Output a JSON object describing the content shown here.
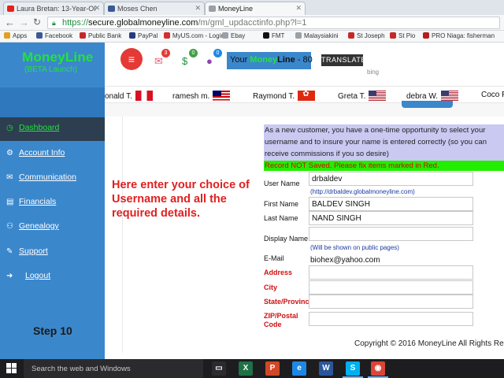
{
  "browser": {
    "tabs": [
      {
        "title": "Laura Bretan: 13-Year-Ol",
        "icon": "youtube-icon",
        "color": "#e62117"
      },
      {
        "title": "Moses Chen",
        "icon": "facebook-icon",
        "color": "#3b5998"
      },
      {
        "title": "MoneyLine",
        "icon": "page-icon",
        "color": "#9aa0a6"
      }
    ],
    "url": {
      "scheme": "https://",
      "domain": "secure.globalmoneyline.com",
      "path": "/m/gml_updacctinfo.php?l=1"
    },
    "bookmarks": [
      {
        "label": "Apps",
        "icon": "apps-icon",
        "color": "#e0a020"
      },
      {
        "label": "Facebook",
        "icon": "facebook-icon",
        "color": "#3b5998"
      },
      {
        "label": "Public Bank",
        "icon": "bank-icon",
        "color": "#c62828"
      },
      {
        "label": "PayPal",
        "icon": "paypal-icon",
        "color": "#253b80"
      },
      {
        "label": "MyUS.com - Login",
        "icon": "myus-icon",
        "color": "#d32f2f"
      },
      {
        "label": "Ebay",
        "icon": "page-icon",
        "color": "#9aa0a6"
      },
      {
        "label": "FMT",
        "icon": "fmt-icon",
        "color": "#111111"
      },
      {
        "label": "Malaysiakini",
        "icon": "page-icon",
        "color": "#9aa0a6"
      },
      {
        "label": "St Joseph",
        "icon": "page-icon",
        "color": "#c62828"
      },
      {
        "label": "St Pio",
        "icon": "page-icon",
        "color": "#c62828"
      },
      {
        "label": "PRO Niaga: fisherman",
        "icon": "pro-icon",
        "color": "#b71c1c"
      }
    ]
  },
  "sidebar": {
    "logo_line1": "MoneyLine",
    "logo_line2": "(BETA Launch)",
    "items": [
      {
        "label": "Dashboard",
        "icon": "dashboard-icon",
        "glyph": "◷"
      },
      {
        "label": "Account Info",
        "icon": "gear-icon",
        "glyph": "⚙"
      },
      {
        "label": "Communication",
        "icon": "envelope-icon",
        "glyph": "✉"
      },
      {
        "label": "Financials",
        "icon": "money-icon",
        "glyph": "▤"
      },
      {
        "label": "Genealogy",
        "icon": "sitemap-icon",
        "glyph": "⚇"
      },
      {
        "label": "Support",
        "icon": "pencil-icon",
        "glyph": "✎"
      },
      {
        "label": "Logout",
        "icon": "logout-icon",
        "glyph": "➜"
      }
    ],
    "step_label": "Step 10"
  },
  "header": {
    "menu_glyph": "≡",
    "notifications": [
      {
        "icon": "envelope-icon",
        "glyph": "✉",
        "badge": "3",
        "color": "#e65b7a",
        "badge_color": "#e53935"
      },
      {
        "icon": "dollar-icon",
        "glyph": "$",
        "badge": "0",
        "color": "#1e8e3e",
        "badge_color": "#43a047"
      },
      {
        "icon": "users-icon",
        "glyph": "●",
        "badge": "0",
        "color": "#8e44ad",
        "badge_color": "#1e88e5"
      }
    ],
    "your_money": {
      "your": "Your ",
      "money": "Money",
      "line": "Line",
      "suffix": " - 80"
    },
    "translate_label": "TRANSLATE",
    "bing_label": "bing"
  },
  "ticker": [
    {
      "name": "onald T.",
      "flag": "peru"
    },
    {
      "name": "ramesh m.",
      "flag": "malaysia"
    },
    {
      "name": "Raymond T.",
      "flag": "hongkong"
    },
    {
      "name": "Greta T.",
      "flag": "usa"
    },
    {
      "name": "debra W.",
      "flag": "usa"
    },
    {
      "name": "Coco F",
      "flag": ""
    }
  ],
  "form": {
    "info_text": "As a new customer, you have a one-time opportunity to select your username and to insure your name is entered correctly (so you can receive commissions if you so desire)",
    "error_text": "Record NOT Saved. Please fix items marked in Red.",
    "instructions": "Here enter your choice of Username and all the required details.",
    "fields": {
      "username": {
        "label": "User Name",
        "value": "drbaldev",
        "hint": "(http://drbaldev.globalmoneyline.com)"
      },
      "first_name": {
        "label": "First Name",
        "value": "BALDEV SINGH"
      },
      "last_name": {
        "label": "Last Name",
        "value": "NAND SINGH"
      },
      "display_name": {
        "label": "Display Name",
        "value": "",
        "hint": "(Will be shown on public pages)"
      },
      "email": {
        "label": "E-Mail",
        "value": "biohex@yahoo.com"
      },
      "address": {
        "label": "Address",
        "value": ""
      },
      "city": {
        "label": "City",
        "value": ""
      },
      "state": {
        "label": "State/Province",
        "value": ""
      },
      "zip": {
        "label": "ZIP/Postal Code",
        "label_line1": "ZIP/Postal",
        "label_line2": "Code",
        "value": ""
      }
    },
    "copyright": "Copyright © 2016 MoneyLine All Rights Re"
  },
  "taskbar": {
    "search_placeholder": "Search the web and Windows",
    "apps": [
      {
        "name": "task-view-icon",
        "glyph": "▭",
        "color": "#2b2b2e"
      },
      {
        "name": "excel-icon",
        "glyph": "X",
        "color": "#1e7145"
      },
      {
        "name": "powerpoint-icon",
        "glyph": "P",
        "color": "#d24726"
      },
      {
        "name": "edge-icon",
        "glyph": "e",
        "color": "#1e88e5"
      },
      {
        "name": "word-icon",
        "glyph": "W",
        "color": "#2b579a"
      },
      {
        "name": "skype-icon",
        "glyph": "S",
        "color": "#00aff0"
      },
      {
        "name": "chrome-icon",
        "glyph": "◉",
        "color": "#db4437"
      }
    ]
  },
  "colors": {
    "sidebar": "#3b87cc",
    "sidebar_active": "#2c3e50",
    "brand_green": "#23e23b",
    "error_red": "#d00000",
    "info_bg": "#c9c9f2",
    "error_bg": "#22ee00"
  }
}
